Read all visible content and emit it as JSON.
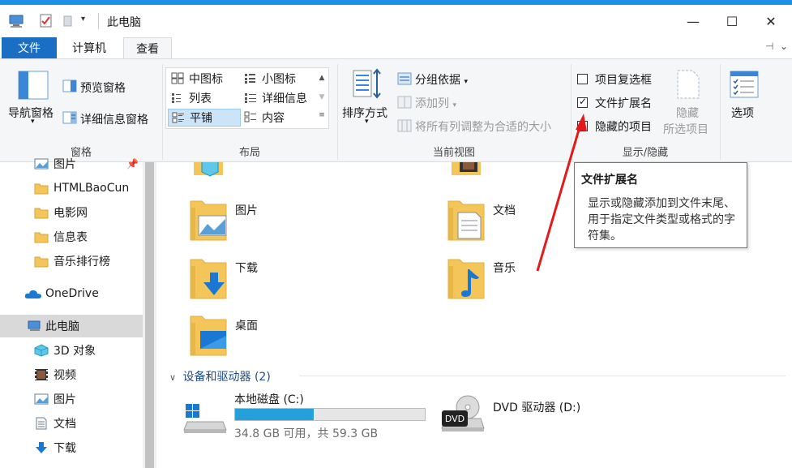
{
  "window": {
    "title": "此电脑",
    "min_glyph": "—",
    "max_glyph": "☐",
    "close_glyph": "✕"
  },
  "tabs": {
    "file": "文件",
    "computer": "计算机",
    "view": "查看"
  },
  "ribbon": {
    "pane": {
      "nav_pane": "导航窗格",
      "preview_pane": "预览窗格",
      "details_pane": "详细信息窗格",
      "label": "窗格"
    },
    "layout": {
      "items": [
        "中图标",
        "小图标",
        "列表",
        "详细信息",
        "平铺",
        "内容"
      ],
      "selected": "平铺",
      "label": "布局"
    },
    "current_view": {
      "sort_by": "排序方式",
      "group_by": "分组依据",
      "add_column": "添加列",
      "size_all_columns": "将所有列调整为合适的大小",
      "label": "当前视图"
    },
    "show_hide": {
      "item_checkboxes": "项目复选框",
      "item_checkboxes_checked": false,
      "file_extensions": "文件扩展名",
      "file_extensions_checked": true,
      "hidden_items": "隐藏的项目",
      "hidden_items_checked": false,
      "hide_selected_line1": "隐藏",
      "hide_selected_line2": "所选项目",
      "label": "显示/隐藏"
    },
    "options": "选项"
  },
  "nav": {
    "items": [
      {
        "label": "图片",
        "icon": "pictures-icon"
      },
      {
        "label": "HTMLBaoCun",
        "icon": "folder-icon"
      },
      {
        "label": "电影网",
        "icon": "folder-icon"
      },
      {
        "label": "信息表",
        "icon": "folder-icon"
      },
      {
        "label": "音乐排行榜",
        "icon": "folder-icon"
      },
      {
        "label": "OneDrive",
        "icon": "onedrive-icon"
      },
      {
        "label": "此电脑",
        "icon": "this-pc-icon"
      },
      {
        "label": "3D 对象",
        "icon": "3d-objects-icon"
      },
      {
        "label": "视频",
        "icon": "videos-icon"
      },
      {
        "label": "图片",
        "icon": "pictures-icon"
      },
      {
        "label": "文档",
        "icon": "documents-icon"
      },
      {
        "label": "下载",
        "icon": "downloads-icon"
      }
    ]
  },
  "content": {
    "folders": [
      {
        "label": "图片"
      },
      {
        "label": "文档"
      },
      {
        "label": "下载"
      },
      {
        "label": "音乐"
      },
      {
        "label": "桌面"
      }
    ],
    "devices_header": "设备和驱动器 (2)",
    "drives": {
      "c_label": "本地磁盘 (C:)",
      "c_sub": "34.8 GB 可用，共 59.3 GB",
      "c_used_fraction": 0.413,
      "d_label": "DVD 驱动器 (D:)",
      "dvd_badge": "DVD"
    }
  },
  "tooltip": {
    "title": "文件扩展名",
    "body": "显示或隐藏添加到文件末尾、用于指定文件类型或格式的字符集。"
  },
  "colors": {
    "accent": "#1a6fc4",
    "folder": "#f4c65a",
    "drive_fill": "#26a0da",
    "arrow": "#e41a1a"
  }
}
